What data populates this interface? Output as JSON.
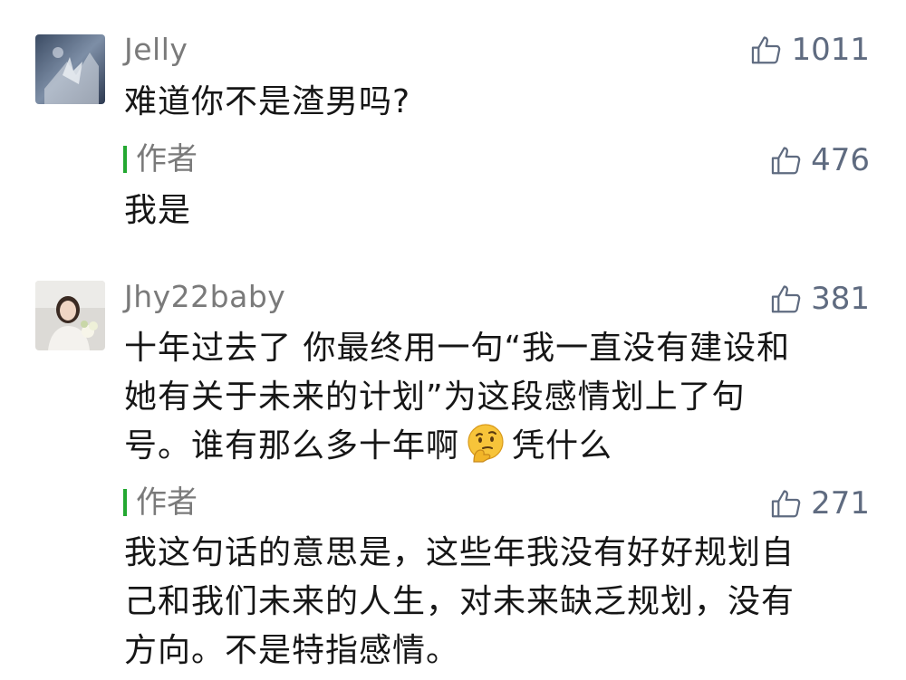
{
  "comments": [
    {
      "username": "Jelly",
      "likes": "1011",
      "text": "难道你不是渣男吗?",
      "reply": {
        "label": "作者",
        "likes": "476",
        "text": "我是"
      }
    },
    {
      "username": "Jhy22baby",
      "likes": "381",
      "text_lines": [
        "十年过去了 你最终用一句“我一直没有建设和",
        "她有关于未来的计划”为这段感情划上了句",
        "号。谁有那么多十年啊"
      ],
      "text_tail": "凭什么",
      "emoji": "thinking-face-emoji",
      "reply": {
        "label": "作者",
        "likes": "271",
        "text_lines": [
          "我这句话的意思是，这些年我没有好好规划自",
          "己和我们未来的人生，对未来缺乏规划，没有",
          "方向。不是特指感情。"
        ]
      }
    }
  ],
  "icons": {
    "like": "thumbs-up-icon"
  },
  "colors": {
    "accent_bar": "#23a831",
    "username": "#7a7a7a",
    "like": "#5f6b80"
  }
}
